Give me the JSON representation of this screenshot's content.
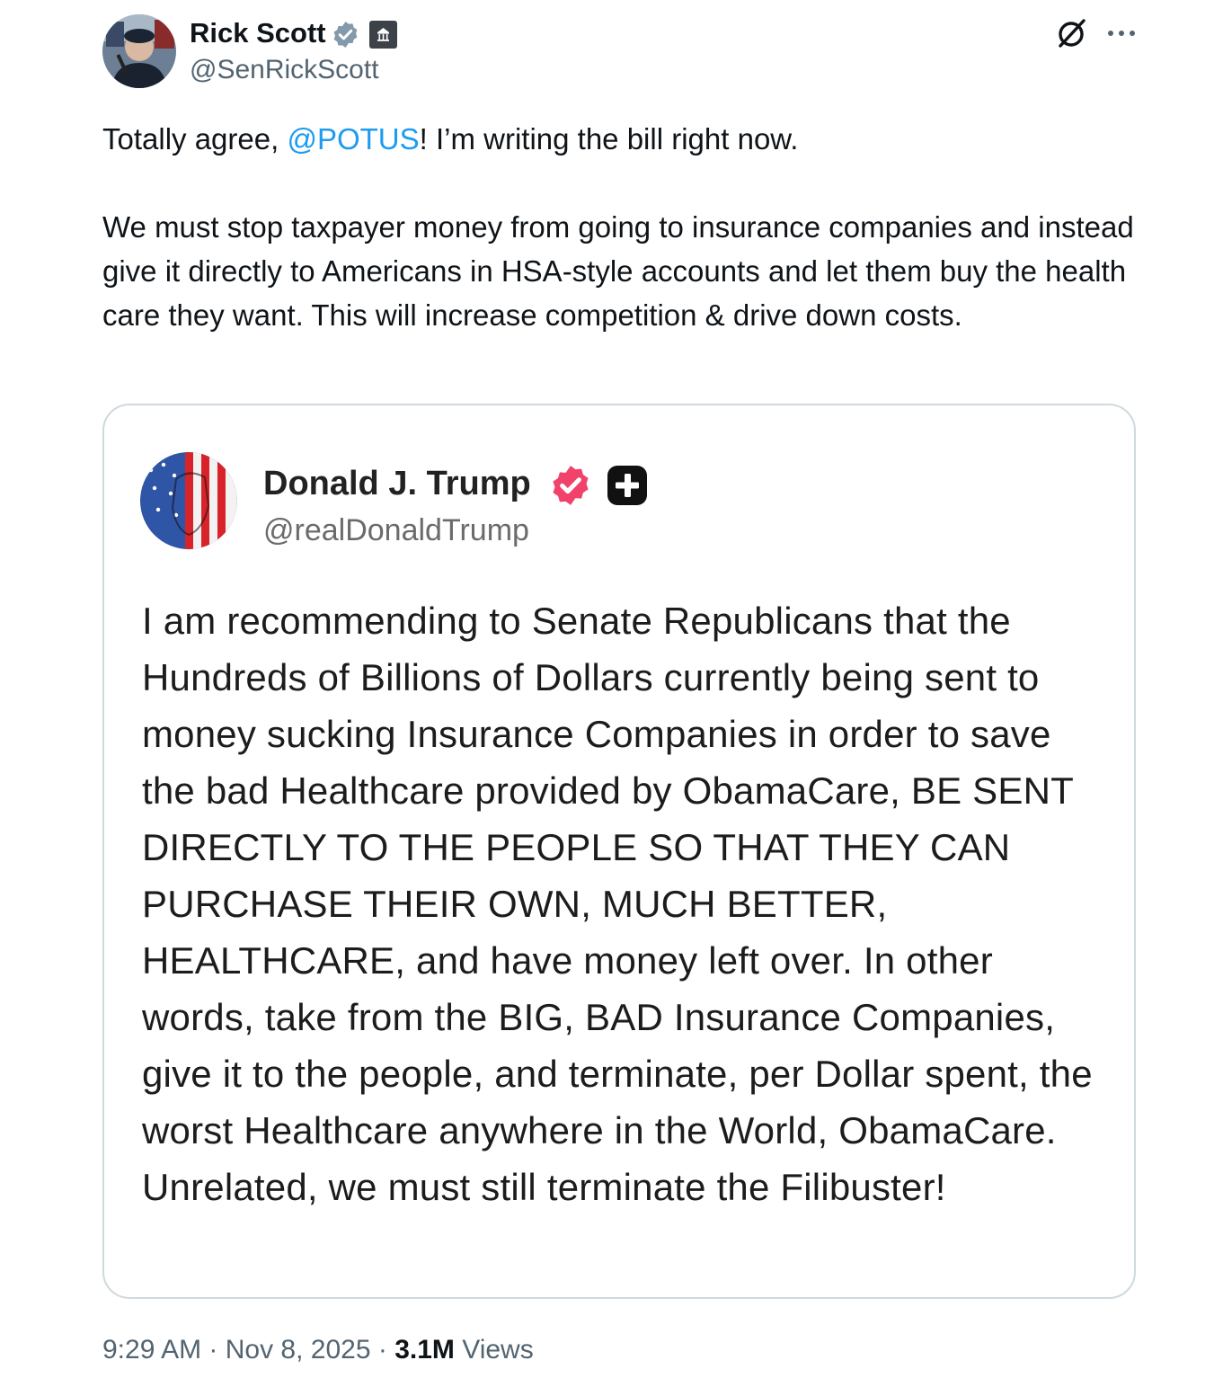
{
  "author": {
    "name": "Rick Scott",
    "handle": "@SenRickScott",
    "verified_badge_color": "#829aab",
    "avatar_icon": "profile-photo"
  },
  "tweet": {
    "intro_before": "Totally agree, ",
    "mention": "@POTUS",
    "intro_after": "! I’m writing the bill right now.",
    "body": "We must stop taxpayer money from going to insurance companies and instead give it directly to Americans in HSA-style accounts and let them buy the health care they want. This will increase competition & drive down costs."
  },
  "quoted_post": {
    "name": "Donald J. Trump",
    "handle": "@realDonaldTrump",
    "verified_badge_color": "#f0426b",
    "text": "I am recommending to Senate Republicans that the Hundreds of Billions of Dollars currently being sent to money sucking Insurance Companies in order to save the bad Healthcare provided by ObamaCare, BE SENT DIRECTLY TO THE PEOPLE SO THAT THEY CAN PURCHASE THEIR OWN, MUCH BETTER, HEALTHCARE, and have money left over. In other words, take from the BIG, BAD Insurance Companies, give it to the people, and terminate, per Dollar spent, the worst Healthcare anywhere in the World, ObamaCare. Unrelated, we must still terminate the Filibuster!"
  },
  "footer": {
    "time": "9:29 AM",
    "separator": " · ",
    "date": "Nov 8, 2025",
    "views_count": "3.1M",
    "views_label": " Views"
  },
  "colors": {
    "link": "#1d9bf0",
    "secondary_text": "#536471",
    "border": "#cfd9de"
  }
}
